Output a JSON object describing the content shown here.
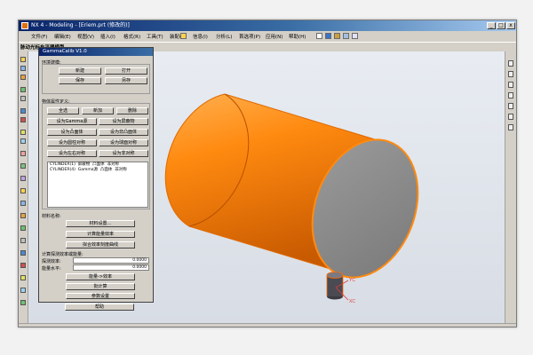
{
  "window": {
    "title": "NX 4 - Modeling - [Eriem.prt (修改的)]",
    "controls": {
      "minimize": "_",
      "maximize": "□",
      "close": "x"
    }
  },
  "menu": [
    "文件(F)",
    "编辑(E)",
    "视图(V)",
    "插入(I)",
    "格式(R)",
    "工具(T)",
    "装配(A)",
    "信息(I)",
    "分析(L)",
    "首选项(P)",
    "应用(N)",
    "帮助(H)"
  ],
  "subbar": {
    "label": "脉动光标车平器模型"
  },
  "dialog": {
    "title": "GammaCalib V1.0",
    "env_section": "环境建模:",
    "btn_new": "新建",
    "btn_open": "打开",
    "btn_save": "保存",
    "btn_saveas": "另存",
    "object_section": "物体属性定义:",
    "btn_select_all": "全选",
    "btn_add": "新加",
    "btn_delete": "删除",
    "btn_set_gamma": "设为Gamma源",
    "btn_set_shield": "设为屏蔽物",
    "btn_set_convex": "设为凸面体",
    "btn_set_nonconvex": "设为非凸面体",
    "btn_set_cyl_sym": "设为圆柱对称",
    "btn_set_sph_sym": "设为球面对称",
    "btn_set_lr_sym": "设为左右对称",
    "btn_set_asym": "设为非对称",
    "list_rows": [
      [
        "CYLINDER(1)",
        "屏蔽物",
        "凸面体",
        "非对称"
      ],
      [
        "CYLINDER(4)",
        "Gamma源",
        "凸面体",
        "非对称"
      ]
    ],
    "material_label": "材料名称:",
    "btn_material": "材料设置…",
    "btn_calc_eff": "计算能量效率",
    "btn_fit_curve": "拟合效率刻度曲线",
    "calc_section": "计算探测效率或能量:",
    "eff_label": "探测效率:",
    "eff_value": "0.0000",
    "energy_label": "能量水平:",
    "energy_value": "0.0000",
    "btn_energy_eff": "能量->效率",
    "btn_batch": "批计算",
    "btn_params": "参数设置",
    "btn_help": "帮助"
  },
  "axes": {
    "y": "YC",
    "x": "XC"
  },
  "colors": {
    "cylinder": "#ff8a10",
    "cylinder_dark": "#c85a00",
    "end_cap": "#8c8c8c",
    "detector_body": "#4a4a52",
    "axis_color": "#e43a3a"
  }
}
